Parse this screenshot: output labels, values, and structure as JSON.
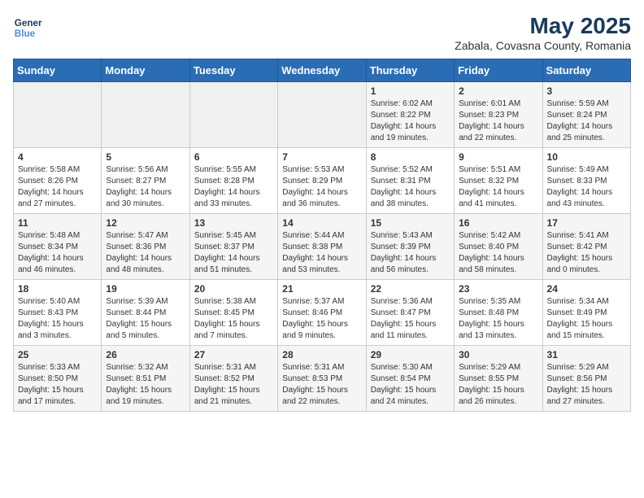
{
  "logo": {
    "line1": "General",
    "line2": "Blue"
  },
  "title": "May 2025",
  "location": "Zabala, Covasna County, Romania",
  "headers": [
    "Sunday",
    "Monday",
    "Tuesday",
    "Wednesday",
    "Thursday",
    "Friday",
    "Saturday"
  ],
  "weeks": [
    [
      {
        "num": "",
        "info": "",
        "empty": true
      },
      {
        "num": "",
        "info": "",
        "empty": true
      },
      {
        "num": "",
        "info": "",
        "empty": true
      },
      {
        "num": "",
        "info": "",
        "empty": true
      },
      {
        "num": "1",
        "info": "Sunrise: 6:02 AM\nSunset: 8:22 PM\nDaylight: 14 hours\nand 19 minutes."
      },
      {
        "num": "2",
        "info": "Sunrise: 6:01 AM\nSunset: 8:23 PM\nDaylight: 14 hours\nand 22 minutes."
      },
      {
        "num": "3",
        "info": "Sunrise: 5:59 AM\nSunset: 8:24 PM\nDaylight: 14 hours\nand 25 minutes."
      }
    ],
    [
      {
        "num": "4",
        "info": "Sunrise: 5:58 AM\nSunset: 8:26 PM\nDaylight: 14 hours\nand 27 minutes."
      },
      {
        "num": "5",
        "info": "Sunrise: 5:56 AM\nSunset: 8:27 PM\nDaylight: 14 hours\nand 30 minutes."
      },
      {
        "num": "6",
        "info": "Sunrise: 5:55 AM\nSunset: 8:28 PM\nDaylight: 14 hours\nand 33 minutes."
      },
      {
        "num": "7",
        "info": "Sunrise: 5:53 AM\nSunset: 8:29 PM\nDaylight: 14 hours\nand 36 minutes."
      },
      {
        "num": "8",
        "info": "Sunrise: 5:52 AM\nSunset: 8:31 PM\nDaylight: 14 hours\nand 38 minutes."
      },
      {
        "num": "9",
        "info": "Sunrise: 5:51 AM\nSunset: 8:32 PM\nDaylight: 14 hours\nand 41 minutes."
      },
      {
        "num": "10",
        "info": "Sunrise: 5:49 AM\nSunset: 8:33 PM\nDaylight: 14 hours\nand 43 minutes."
      }
    ],
    [
      {
        "num": "11",
        "info": "Sunrise: 5:48 AM\nSunset: 8:34 PM\nDaylight: 14 hours\nand 46 minutes."
      },
      {
        "num": "12",
        "info": "Sunrise: 5:47 AM\nSunset: 8:36 PM\nDaylight: 14 hours\nand 48 minutes."
      },
      {
        "num": "13",
        "info": "Sunrise: 5:45 AM\nSunset: 8:37 PM\nDaylight: 14 hours\nand 51 minutes."
      },
      {
        "num": "14",
        "info": "Sunrise: 5:44 AM\nSunset: 8:38 PM\nDaylight: 14 hours\nand 53 minutes."
      },
      {
        "num": "15",
        "info": "Sunrise: 5:43 AM\nSunset: 8:39 PM\nDaylight: 14 hours\nand 56 minutes."
      },
      {
        "num": "16",
        "info": "Sunrise: 5:42 AM\nSunset: 8:40 PM\nDaylight: 14 hours\nand 58 minutes."
      },
      {
        "num": "17",
        "info": "Sunrise: 5:41 AM\nSunset: 8:42 PM\nDaylight: 15 hours\nand 0 minutes."
      }
    ],
    [
      {
        "num": "18",
        "info": "Sunrise: 5:40 AM\nSunset: 8:43 PM\nDaylight: 15 hours\nand 3 minutes."
      },
      {
        "num": "19",
        "info": "Sunrise: 5:39 AM\nSunset: 8:44 PM\nDaylight: 15 hours\nand 5 minutes."
      },
      {
        "num": "20",
        "info": "Sunrise: 5:38 AM\nSunset: 8:45 PM\nDaylight: 15 hours\nand 7 minutes."
      },
      {
        "num": "21",
        "info": "Sunrise: 5:37 AM\nSunset: 8:46 PM\nDaylight: 15 hours\nand 9 minutes."
      },
      {
        "num": "22",
        "info": "Sunrise: 5:36 AM\nSunset: 8:47 PM\nDaylight: 15 hours\nand 11 minutes."
      },
      {
        "num": "23",
        "info": "Sunrise: 5:35 AM\nSunset: 8:48 PM\nDaylight: 15 hours\nand 13 minutes."
      },
      {
        "num": "24",
        "info": "Sunrise: 5:34 AM\nSunset: 8:49 PM\nDaylight: 15 hours\nand 15 minutes."
      }
    ],
    [
      {
        "num": "25",
        "info": "Sunrise: 5:33 AM\nSunset: 8:50 PM\nDaylight: 15 hours\nand 17 minutes."
      },
      {
        "num": "26",
        "info": "Sunrise: 5:32 AM\nSunset: 8:51 PM\nDaylight: 15 hours\nand 19 minutes."
      },
      {
        "num": "27",
        "info": "Sunrise: 5:31 AM\nSunset: 8:52 PM\nDaylight: 15 hours\nand 21 minutes."
      },
      {
        "num": "28",
        "info": "Sunrise: 5:31 AM\nSunset: 8:53 PM\nDaylight: 15 hours\nand 22 minutes."
      },
      {
        "num": "29",
        "info": "Sunrise: 5:30 AM\nSunset: 8:54 PM\nDaylight: 15 hours\nand 24 minutes."
      },
      {
        "num": "30",
        "info": "Sunrise: 5:29 AM\nSunset: 8:55 PM\nDaylight: 15 hours\nand 26 minutes."
      },
      {
        "num": "31",
        "info": "Sunrise: 5:29 AM\nSunset: 8:56 PM\nDaylight: 15 hours\nand 27 minutes."
      }
    ]
  ]
}
